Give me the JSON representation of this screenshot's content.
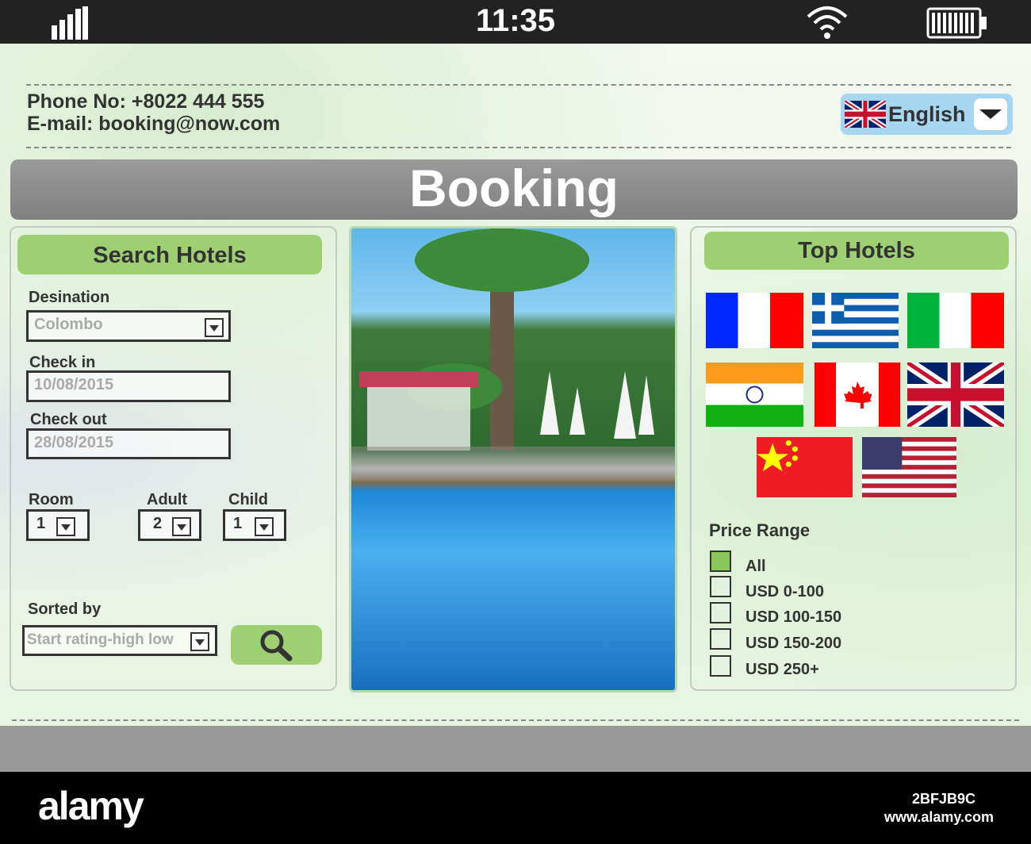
{
  "status_bar": {
    "time": "11:35",
    "signal_icon": "signal-icon",
    "wifi_icon": "wifi-icon",
    "battery_icon": "battery-icon"
  },
  "contact": {
    "phone": "Phone No: +8022 444 555",
    "email": "E-mail: booking@now.com"
  },
  "language": {
    "selected": "English",
    "flag": "uk-flag"
  },
  "banner": {
    "title": "Booking"
  },
  "search": {
    "title": "Search Hotels",
    "destination_label": "Desination",
    "destination_value": "Colombo",
    "checkin_label": "Check in",
    "checkin_value": "10/08/2015",
    "checkout_label": "Check out",
    "checkout_value": "28/08/2015",
    "room_label": "Room",
    "room_value": "1",
    "adult_label": "Adult",
    "adult_value": "2",
    "child_label": "Child",
    "child_value": "1",
    "sorted_label": "Sorted by",
    "sorted_value": "Start rating-high low",
    "search_icon": "search-icon"
  },
  "top_hotels": {
    "title": "Top Hotels",
    "flags": [
      "France",
      "Greece",
      "Italy",
      "India",
      "Canada",
      "United Kingdom",
      "China",
      "USA"
    ]
  },
  "price_range": {
    "title": "Price Range",
    "options": [
      {
        "label": "All",
        "checked": true
      },
      {
        "label": "USD 0-100",
        "checked": false
      },
      {
        "label": "USD 100-150",
        "checked": false
      },
      {
        "label": "USD 150-200",
        "checked": false
      },
      {
        "label": "USD 250+",
        "checked": false
      }
    ],
    "accent": "#9ed073"
  },
  "watermark": {
    "logo": "alamy",
    "image_id": "2BFJB9C",
    "url": "www.alamy.com"
  }
}
